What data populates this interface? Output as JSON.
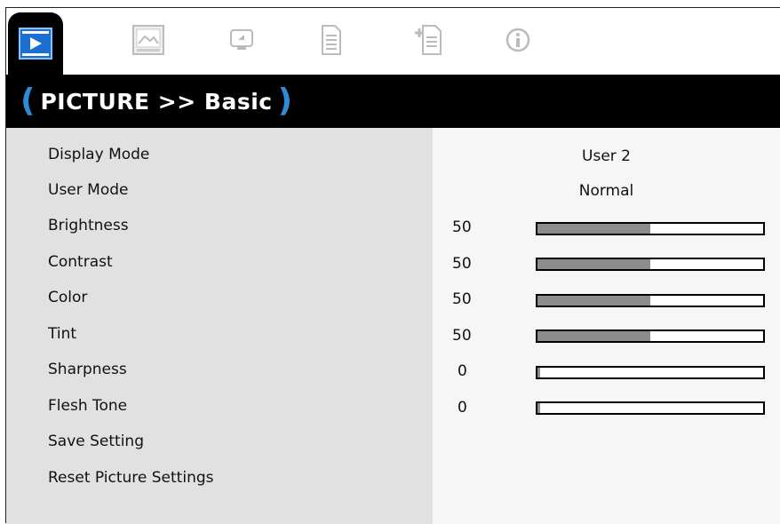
{
  "header": {
    "open_paren": "(",
    "title": "PICTURE >> Basic",
    "close_paren": ")"
  },
  "tabs": [
    {
      "icon": "picture-play-icon",
      "active": true
    },
    {
      "icon": "image-adjust-icon",
      "active": false
    },
    {
      "icon": "display-icon",
      "active": false
    },
    {
      "icon": "settings-document-icon",
      "active": false
    },
    {
      "icon": "document-add-icon",
      "active": false
    },
    {
      "icon": "info-icon",
      "active": false
    }
  ],
  "menu": {
    "items": [
      "Display Mode",
      "User Mode",
      "Brightness",
      "Contrast",
      "Color",
      "Tint",
      "Sharpness",
      "Flesh Tone",
      "Save Setting",
      "Reset Picture Settings"
    ]
  },
  "values": {
    "display_mode": "User 2",
    "user_mode": "Normal",
    "sliders": [
      {
        "name": "brightness",
        "value": "50",
        "fraction": 0.5
      },
      {
        "name": "contrast",
        "value": "50",
        "fraction": 0.5
      },
      {
        "name": "color",
        "value": "50",
        "fraction": 0.5
      },
      {
        "name": "tint",
        "value": "50",
        "fraction": 0.5
      },
      {
        "name": "sharpness",
        "value": "0",
        "fraction": 0
      },
      {
        "name": "flesh-tone",
        "value": "0",
        "fraction": 0
      }
    ]
  },
  "colors": {
    "accent": "#2f8ad8",
    "slider_fill": "#8c8c8c",
    "left_panel": "#e1e1e1",
    "right_panel": "#f6f6f6"
  }
}
